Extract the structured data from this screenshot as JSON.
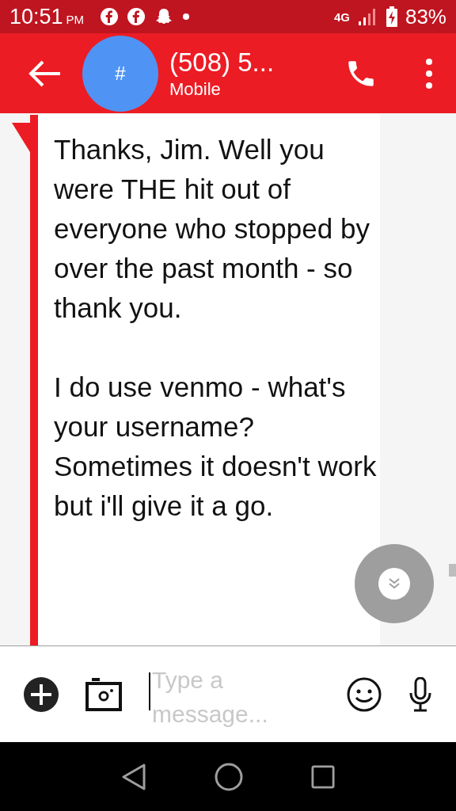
{
  "status_bar": {
    "time": "10:51",
    "ampm": "PM",
    "network": "4G",
    "battery": "83%"
  },
  "header": {
    "avatar": "#",
    "title": "(508) 5...",
    "subtitle": "Mobile"
  },
  "message": {
    "paragraphs": [
      "Thanks, Jim. Well you were THE hit out of everyone who stopped by over the past month - so thank you.",
      "I do use venmo - what's your username? Sometimes it doesn't work but i'll give it a go."
    ]
  },
  "composer": {
    "placeholder": "Type a message..."
  }
}
